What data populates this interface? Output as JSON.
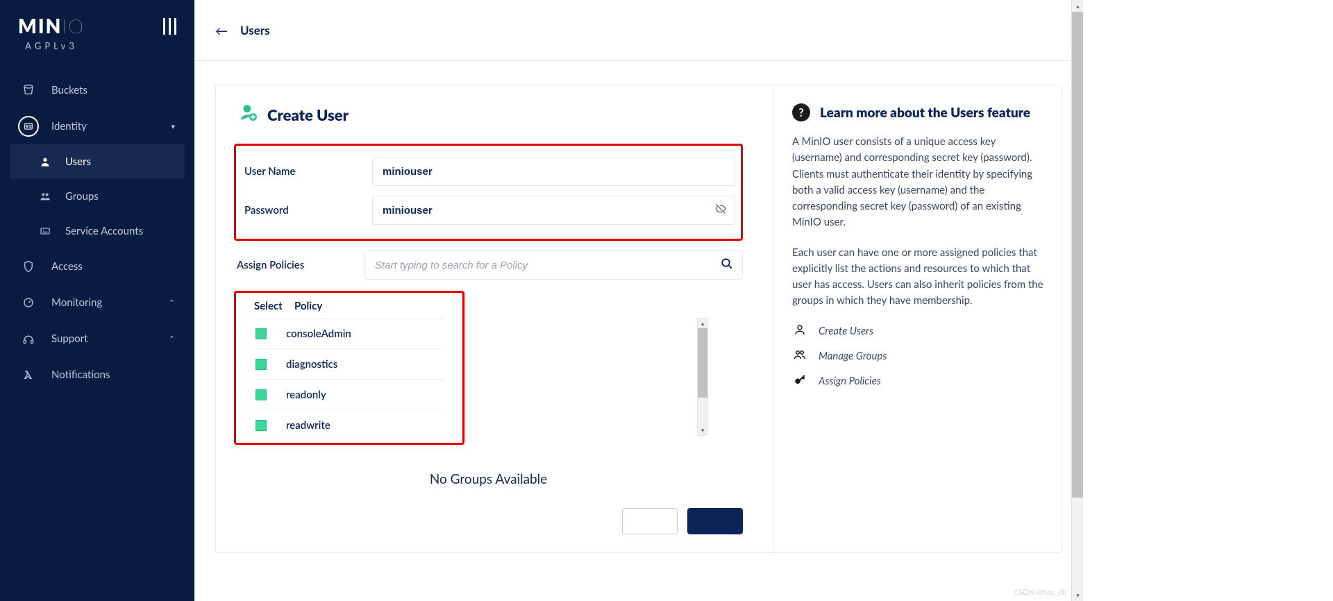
{
  "brand": {
    "name": "MINIO",
    "license": "AGPLv3"
  },
  "sidebar": {
    "items": [
      {
        "label": "Buckets"
      },
      {
        "label": "Identity",
        "expanded": true,
        "children": [
          {
            "label": "Users",
            "active": true
          },
          {
            "label": "Groups"
          },
          {
            "label": "Service Accounts"
          }
        ]
      },
      {
        "label": "Access"
      },
      {
        "label": "Monitoring",
        "chevron": "up"
      },
      {
        "label": "Support",
        "chevron": "up"
      },
      {
        "label": "Notifications"
      }
    ]
  },
  "header": {
    "breadcrumb": "Users"
  },
  "form": {
    "title": "Create User",
    "username_label": "User Name",
    "username_value": "miniouser",
    "password_label": "Password",
    "password_value": "miniouser",
    "assign_label": "Assign Policies",
    "assign_placeholder": "Start typing to search for a Policy",
    "table": {
      "col_select": "Select",
      "col_policy": "Policy",
      "rows": [
        {
          "name": "consoleAdmin",
          "checked": true
        },
        {
          "name": "diagnostics",
          "checked": true
        },
        {
          "name": "readonly",
          "checked": true
        },
        {
          "name": "readwrite",
          "checked": true
        }
      ]
    },
    "no_groups": "No Groups Available"
  },
  "info": {
    "title": "Learn more about the Users feature",
    "p1": "A MinIO user consists of a unique access key (username) and corresponding secret key (password). Clients must authenticate their identity by specifying both a valid access key (username) and the corresponding secret key (password) of an existing MinIO user.",
    "p2": "Each user can have one or more assigned policies that explicitly list the actions and resources to which that user has access. Users can also inherit policies from the groups in which they have membership.",
    "links": [
      {
        "label": "Create Users"
      },
      {
        "label": "Manage Groups"
      },
      {
        "label": "Assign Policies"
      }
    ]
  }
}
